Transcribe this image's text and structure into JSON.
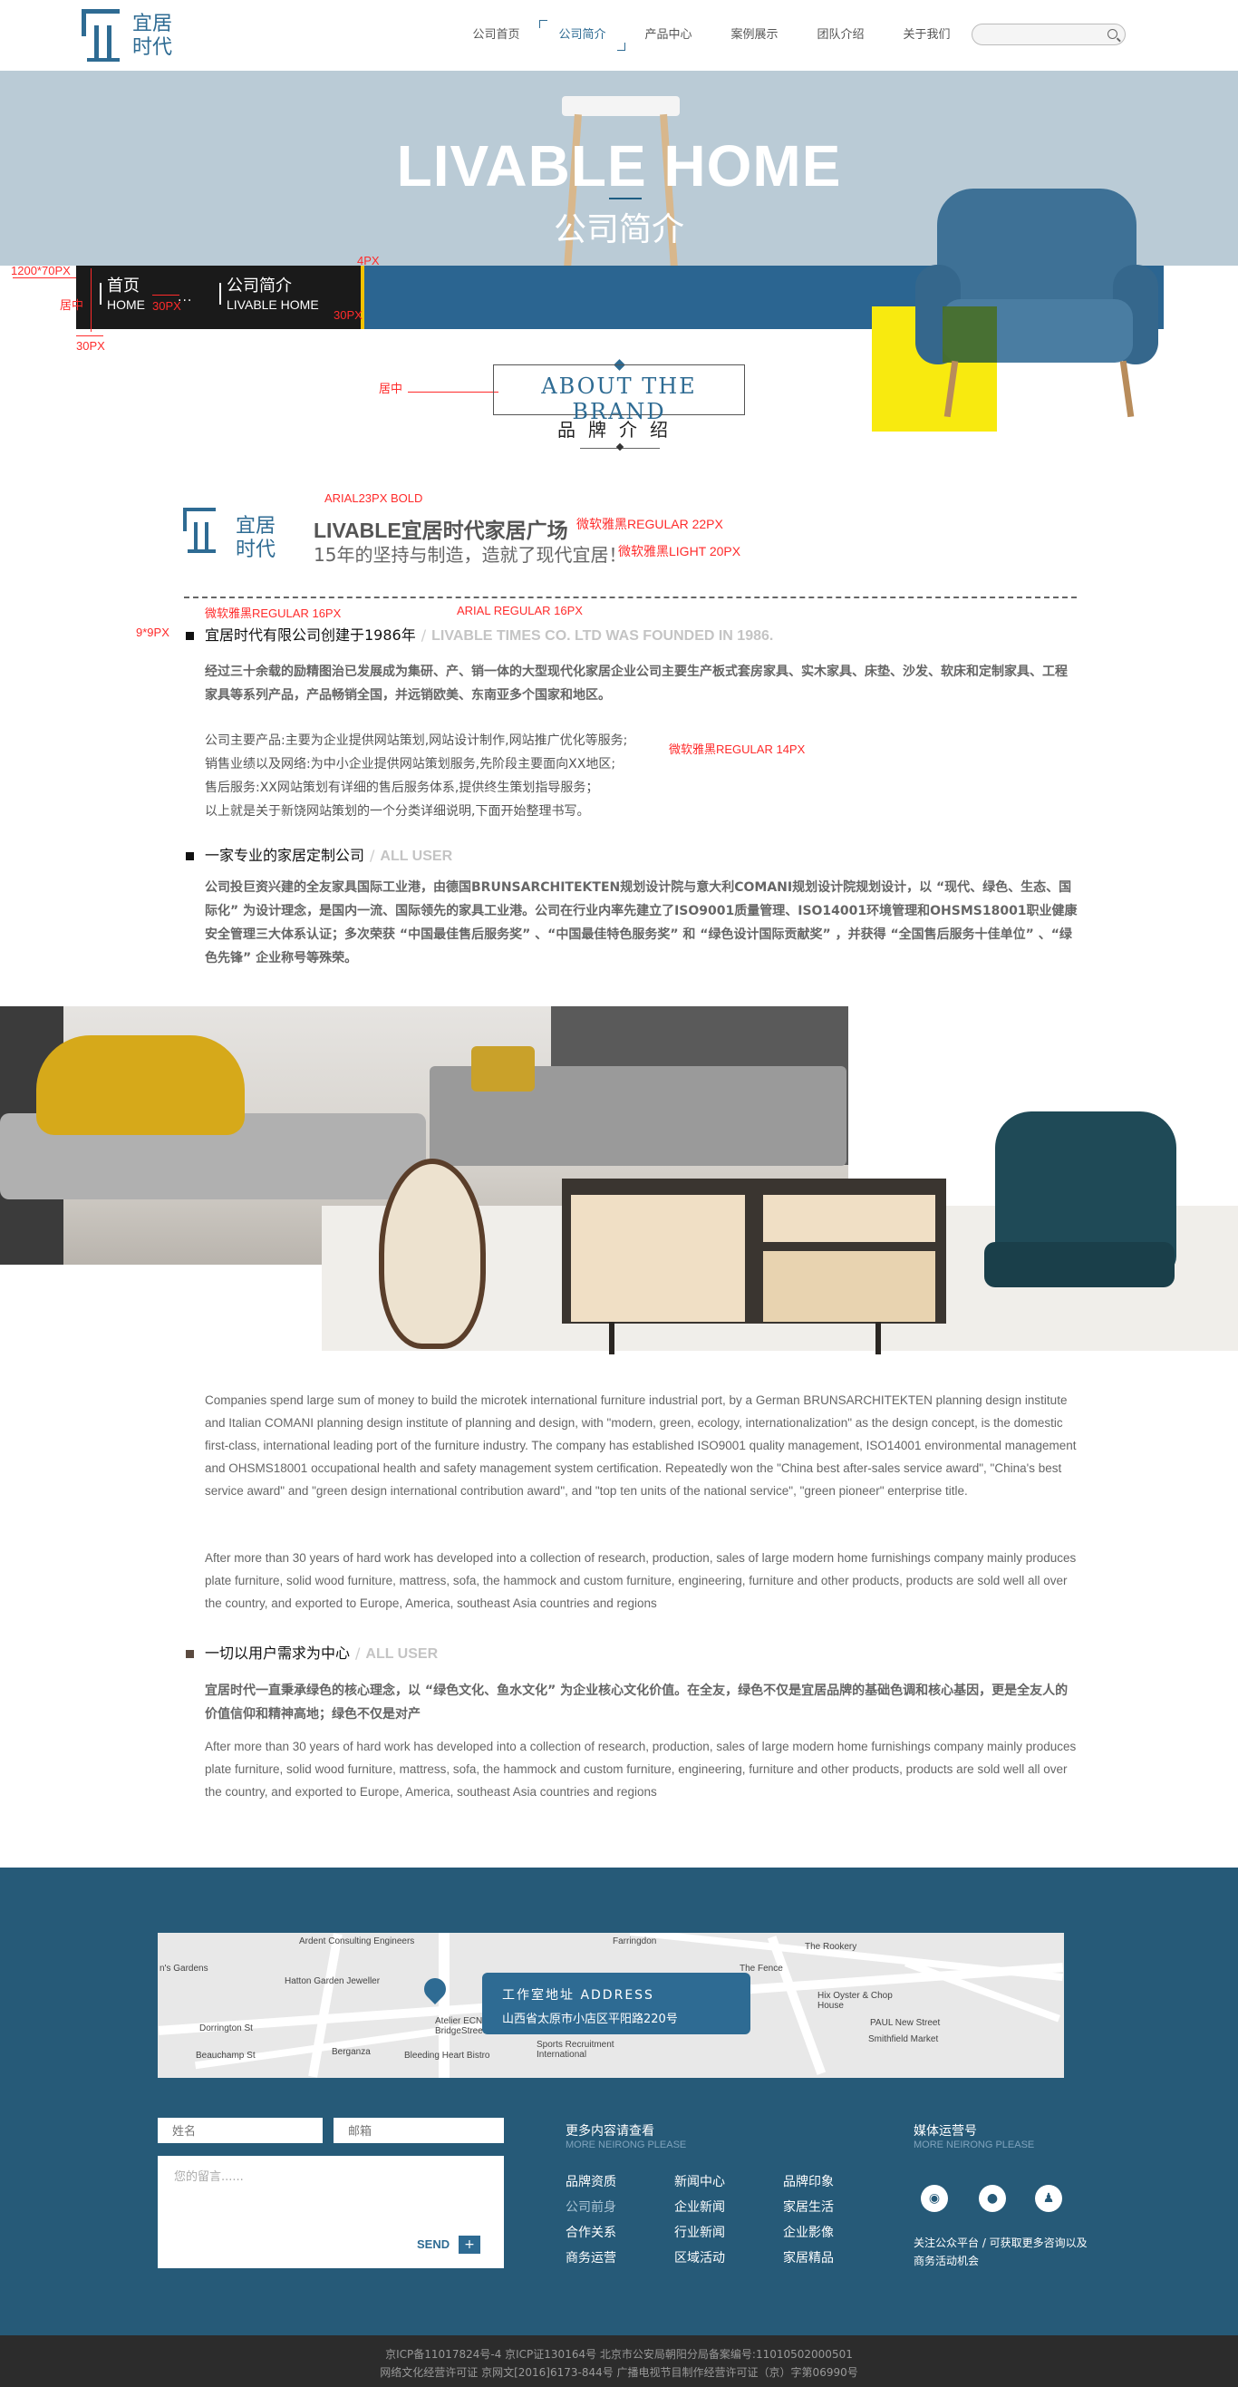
{
  "header": {
    "logo_line1": "宜居",
    "logo_line2": "时代",
    "nav": [
      "公司首页",
      "公司简介",
      "产品中心",
      "案例展示",
      "团队介绍",
      "关于我们"
    ],
    "active_nav": 1,
    "search_placeholder": ""
  },
  "banner": {
    "title": "LIVABLE HOME",
    "subtitle": "公司简介"
  },
  "breadcrumb": {
    "home_cn": "首页",
    "home_en": "HOME",
    "dots": "...",
    "current_cn": "公司简介",
    "current_en": "LIVABLE HOME"
  },
  "annotations": {
    "size": "1200*70PX",
    "center1": "居中",
    "px30a": "30PX",
    "px30b": "30PX",
    "px30c": "30PX",
    "px4": "4PX",
    "center2": "居中",
    "arial23": "ARIAL23PX   BOLD",
    "yahei22": "微软雅黑REGULAR 22PX",
    "yahei20": "微软雅黑LIGHT 20PX",
    "yahei16": "微软雅黑REGULAR 16PX",
    "arial16": "ARIAL    REGULAR 16PX",
    "sq9": "9*9PX",
    "yahei14": "微软雅黑REGULAR 14PX"
  },
  "brand": {
    "title_en": "ABOUT THE BRAND",
    "title_cn": "品牌介绍"
  },
  "company": {
    "logo_line1": "宜居",
    "logo_line2": "时代",
    "title": "LIVABLE宜居时代家居广场",
    "slogan": "15年的坚持与制造，造就了现代宜居！"
  },
  "section1": {
    "title_cn": "宜居时代有限公司创建于1986年",
    "sep": "/",
    "title_en": "LIVABLE TIMES CO. LTD WAS FOUNDED IN 1986.",
    "para1": "经过三十余载的励精图治已发展成为集研、产、销一体的大型现代化家居企业公司主要生产板式套房家具、实木家具、床垫、沙发、软床和定制家具、工程家具等系列产品，产品畅销全国，并远销欧美、东南亚多个国家和地区。",
    "list": [
      "公司主要产品:主要为企业提供网站策划,网站设计制作,网站推广优化等服务;",
      "销售业绩以及网络:为中小企业提供网站策划服务,先阶段主要面向XX地区;",
      "售后服务:XX网站策划有详细的售后服务体系,提供终生策划指导服务；",
      "以上就是关于新饶网站策划的一个分类详细说明,下面开始整理书写。"
    ]
  },
  "section2": {
    "title_cn": "一家专业的家居定制公司",
    "sep": "/",
    "title_en": "ALL USER",
    "para": "公司投巨资兴建的全友家具国际工业港，由德国BRUNSARCHITEKTEN规划设计院与意大利COMANI规划设计院规划设计，以 “现代、绿色、生态、国际化” 为设计理念，是国内一流、国际领先的家具工业港。公司在行业内率先建立了ISO9001质量管理、ISO14001环境管理和OHSMS18001职业健康安全管理三大体系认证；多次荣获 “中国最佳售后服务奖” 、“中国最佳特色服务奖” 和 “绿色设计国际贡献奖” ，并获得 “全国售后服务十佳单位” 、“绿色先锋” 企业称号等殊荣。"
  },
  "english": {
    "para1": "Companies spend large sum of money to build the microtek international furniture industrial port, by a German BRUNSARCHITEKTEN planning design institute and Italian COMANI planning design institute of planning and design, with \"modern, green, ecology, internationalization\" as the design concept, is the domestic first-class, international leading port of the furniture industry. The company has established ISO9001 quality management, ISO14001 environmental management and OHSMS18001 occupational health and safety management system certification. Repeatedly won the \"China best after-sales service award\", \"China's best service award\" and \"green design international contribution award\", and \"top ten units of the national service\", \"green pioneer\" enterprise title.",
    "para2": "After more than 30 years of hard work has developed into a collection of research, production, sales of large modern home furnishings company mainly produces plate furniture, solid wood furniture, mattress, sofa, the hammock and custom furniture, engineering, furniture and other products, products are sold well all over the country, and exported to Europe, America, southeast Asia countries and regions"
  },
  "section3": {
    "title_cn": "一切以用户需求为中心",
    "sep": "/",
    "title_en": "ALL USER",
    "para_cn": "宜居时代一直秉承绿色的核心理念，以 “绿色文化、鱼水文化” 为企业核心文化价值。在全友，绿色不仅是宜居品牌的基础色调和核心基因，更是全友人的价值信仰和精神高地；绿色不仅是对产",
    "para_en": "After more than 30 years of hard work has developed into a collection of research, production, sales of large modern home furnishings company mainly produces plate furniture, solid wood furniture, mattress, sofa, the hammock and custom furniture, engineering, furniture and other products, products are sold well all over the country, and exported to Europe, America, southeast Asia countries and regions"
  },
  "map": {
    "labels": [
      "Ardent Consulting Engineers",
      "Hatton Garden Jeweller",
      "Dorrington St",
      "Beauchamp St",
      "Berganza",
      "Bleeding Heart Bistro",
      "Farringdon",
      "The Rookery",
      "The Fence",
      "Hix Oyster & Chop House",
      "PAUL New Street",
      "Smithfield Market",
      "Sports Recruitment International",
      "Atelier ECN BridgeStreet",
      "n's Gardens"
    ],
    "card_title": "工作室地址 ADDRESS",
    "card_address": "山西省太原市小店区平阳路220号"
  },
  "form": {
    "name_placeholder": "姓名",
    "email_placeholder": "邮箱",
    "message_placeholder": "您的留言......",
    "send": "SEND",
    "plus": "+"
  },
  "more": {
    "title": "更多内容请查看",
    "sub": "MORE NEIRONG PLEASE",
    "links": [
      "品牌资质",
      "新闻中心",
      "品牌印象",
      "公司前身",
      "企业新闻",
      "家居生活",
      "合作关系",
      "行业新闻",
      "企业影像",
      "商务运营",
      "区域活动",
      "家居精品"
    ]
  },
  "media": {
    "title": "媒体运营号",
    "sub": "MORE NEIRONG PLEASE",
    "note": "关注公众平台 / 可获取更多咨询以及商务活动机会",
    "icons": [
      "weibo-icon",
      "wechat-icon",
      "qq-icon"
    ]
  },
  "bottom": {
    "line1": "京ICP备11017824号-4  京ICP证130164号  北京市公安局朝阳分局备案编号:11010502000501",
    "line2": "网络文化经营许可证 京网文[2016]6173-844号  广播电视节目制作经营许可证（京）字第06990号"
  },
  "colors": {
    "brand_blue": "#2e6b93",
    "footer_bg": "#265a78",
    "accent_yellow": "#f8ea0f",
    "annotation_red": "#ff2b2b"
  }
}
